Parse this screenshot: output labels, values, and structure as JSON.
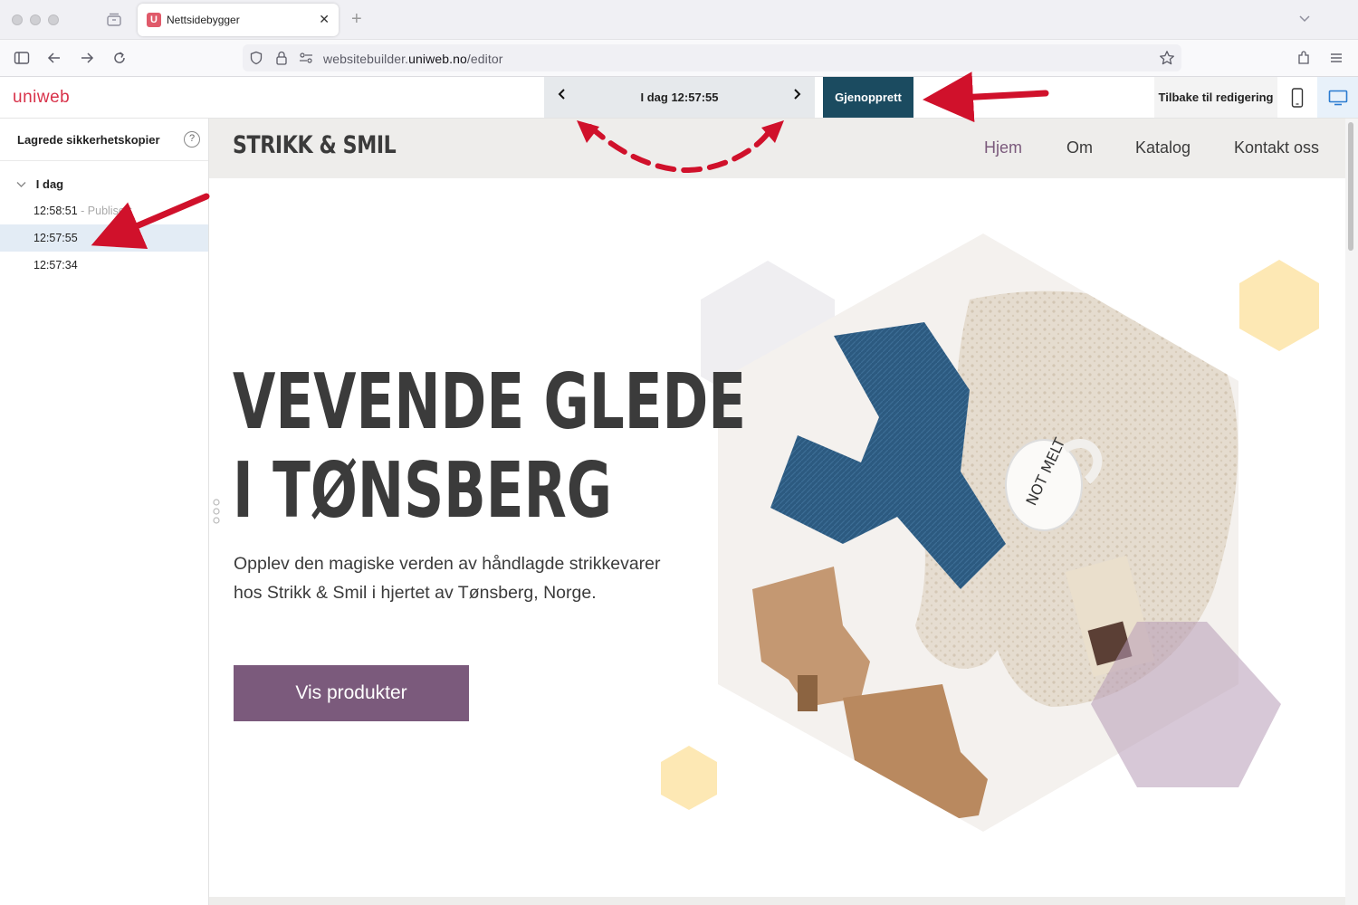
{
  "browser": {
    "tab_title": "Nettsidebygger",
    "tab_favicon": "U",
    "url_prefix": "websitebuilder.",
    "url_domain": "uniweb.no",
    "url_path": "/editor"
  },
  "editor": {
    "logo": "uniweb",
    "version_label": "I dag 12:57:55",
    "restore_label": "Gjenopprett",
    "back_to_edit_label": "Tilbake til redigering"
  },
  "sidebar": {
    "title": "Lagrede sikkerhetskopier",
    "help": "?",
    "group_label": "I dag",
    "entries": [
      {
        "time": "12:58:51",
        "note": " - Publisert"
      },
      {
        "time": "12:57:55",
        "note": ""
      },
      {
        "time": "12:57:34",
        "note": ""
      }
    ]
  },
  "site": {
    "brand": "STRIKK & SMIL",
    "menu": [
      "Hjem",
      "Om",
      "Katalog",
      "Kontakt oss"
    ],
    "hero_line1": "VEVENDE GLEDE",
    "hero_line2": "I TØNSBERG",
    "hero_text": "Opplev den magiske verden av håndlagde strikkevarer hos Strikk & Smil i hjertet av Tønsberg, Norge.",
    "cta": "Vis produkter",
    "mug_text": "NOT MELT"
  },
  "colors": {
    "accent_purple": "#7b5a7c",
    "restore_bg": "#1b4b60",
    "logo_red": "#d8324a",
    "arrow_red": "#d0112b"
  }
}
